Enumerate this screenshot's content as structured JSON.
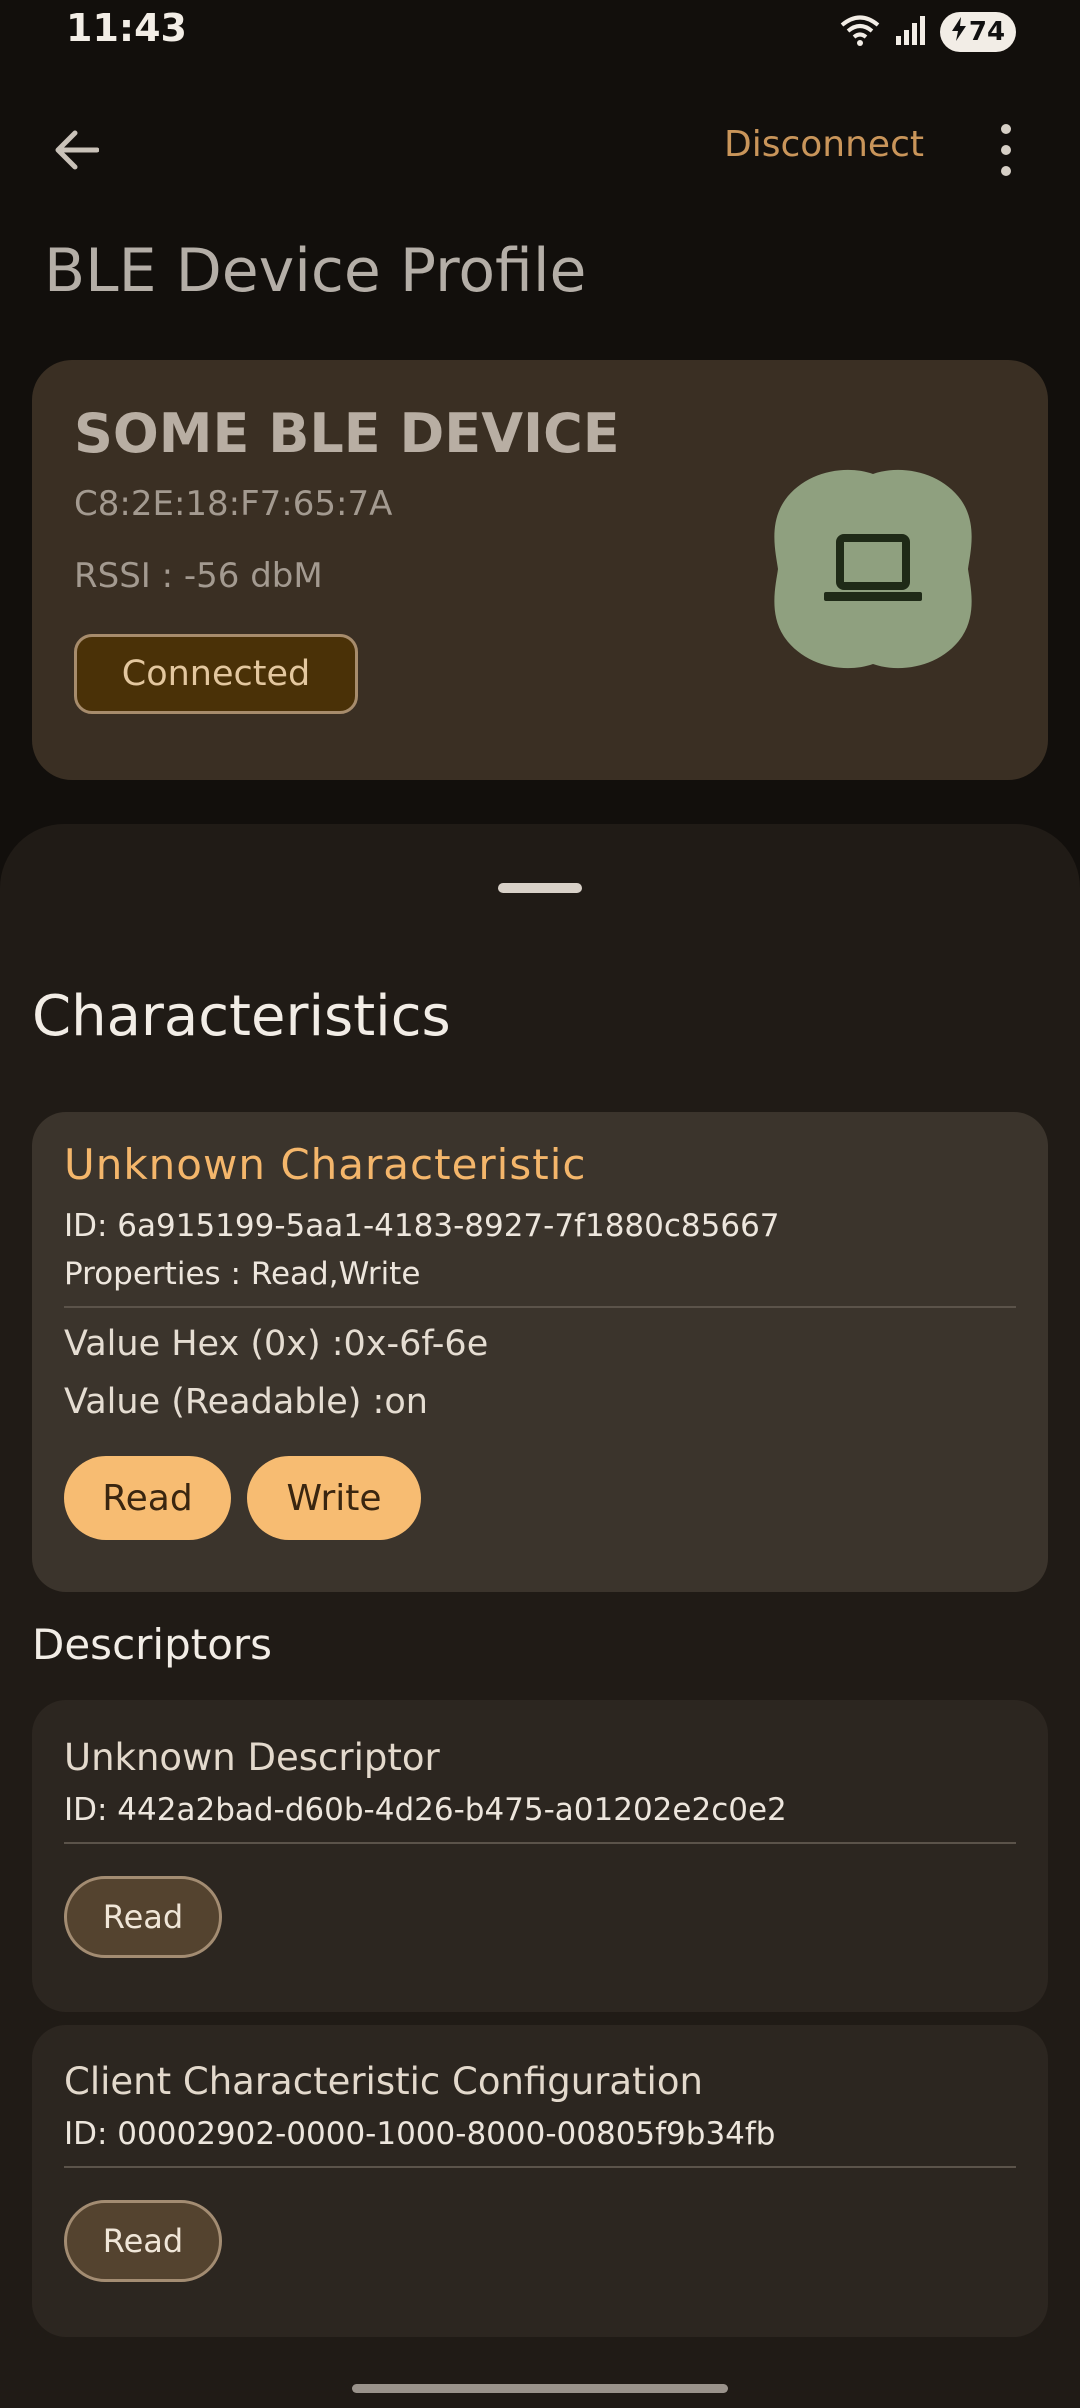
{
  "status_bar": {
    "time": "11:43",
    "battery": "74"
  },
  "app_bar": {
    "action_label": "Disconnect",
    "title": "BLE Device Profile"
  },
  "device": {
    "name": "SOME BLE DEVICE",
    "mac": "C8:2E:18:F7:65:7A",
    "rssi": "RSSI : -56 dbM",
    "status": "Connected",
    "icon": "laptop-icon"
  },
  "characteristics": {
    "heading": "Characteristics",
    "items": [
      {
        "name": "Unknown Characteristic",
        "id": "ID: 6a915199-5aa1-4183-8927-7f1880c85667",
        "properties": "Properties : Read,Write",
        "value_hex": "Value Hex (0x) :0x-6f-6e",
        "value_readable": "Value (Readable) :on",
        "read_label": "Read",
        "write_label": "Write"
      }
    ]
  },
  "descriptors": {
    "heading": "Descriptors",
    "items": [
      {
        "name": "Unknown Descriptor",
        "id": "ID: 442a2bad-d60b-4d26-b475-a01202e2c0e2",
        "read_label": "Read"
      },
      {
        "name": "Client Characteristic Configuration",
        "id": "ID: 00002902-0000-1000-8000-00805f9b34fb",
        "read_label": "Read"
      }
    ]
  },
  "colors": {
    "accent": "#f7bc72",
    "background": "#120f0c",
    "sheet": "#201b16",
    "device_card": "#3a2f23",
    "avatar": "#8fa07f"
  }
}
